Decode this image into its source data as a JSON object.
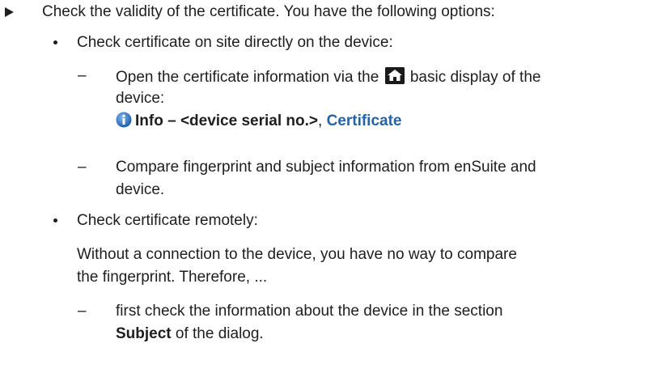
{
  "step": {
    "text": "Check the validity of the certificate. You have the following options:"
  },
  "option_onsite": {
    "label": "Check certificate on site directly on the device:",
    "dash": "–",
    "item1": {
      "before_icon": "Open the certificate information via the",
      "after_icon": "basic display of the",
      "line2": "device:",
      "icon": "home-icon"
    },
    "path": {
      "icon": "info-icon",
      "info_label": "Info – <device serial no.>",
      "separator": ",",
      "certificate_label": "Certificate"
    },
    "item2": {
      "line1": "Compare fingerprint and subject information from enSuite and",
      "line2": "device."
    }
  },
  "option_remote": {
    "label": "Check certificate remotely:",
    "para_line1": "Without a connection to the device, you have no way to compare",
    "para_line2": "the fingerprint. Therefore, ...",
    "dash": "–",
    "item1": {
      "line1": "first check the information about the device in the section",
      "subject": "Subject",
      "rest": " of the dialog."
    }
  }
}
